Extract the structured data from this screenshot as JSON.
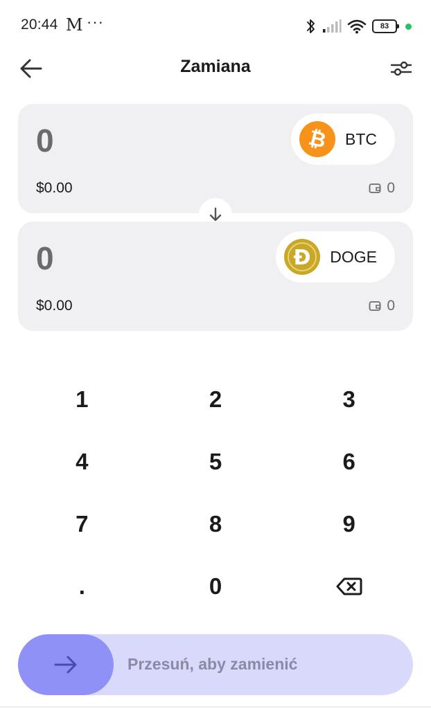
{
  "status_bar": {
    "time": "20:44",
    "carrier_icon": "M",
    "more": "···",
    "battery": "83",
    "icons": [
      "bluetooth-icon",
      "signal-icon",
      "wifi-icon",
      "battery-icon",
      "green-dot"
    ]
  },
  "header": {
    "title": "Zamiana",
    "back_icon": "arrow-left-icon",
    "settings_icon": "sliders-icon"
  },
  "from": {
    "amount": "0",
    "usd_value": "$0.00",
    "balance": "0",
    "token": {
      "symbol": "BTC",
      "logo_glyph": "₿",
      "color": "#f7931a"
    }
  },
  "to": {
    "amount": "0",
    "usd_value": "$0.00",
    "balance": "0",
    "token": {
      "symbol": "DOGE",
      "logo_glyph": "Ð",
      "color": "#c8a826"
    }
  },
  "keypad": {
    "keys": [
      "1",
      "2",
      "3",
      "4",
      "5",
      "6",
      "7",
      "8",
      "9",
      ".",
      "0",
      "backspace"
    ]
  },
  "slider": {
    "label": "Przesuń, aby zamienić"
  },
  "colors": {
    "card_bg": "#f0f0f2",
    "slider_track": "#d9d9fc",
    "slider_knob": "#8f91f7"
  }
}
